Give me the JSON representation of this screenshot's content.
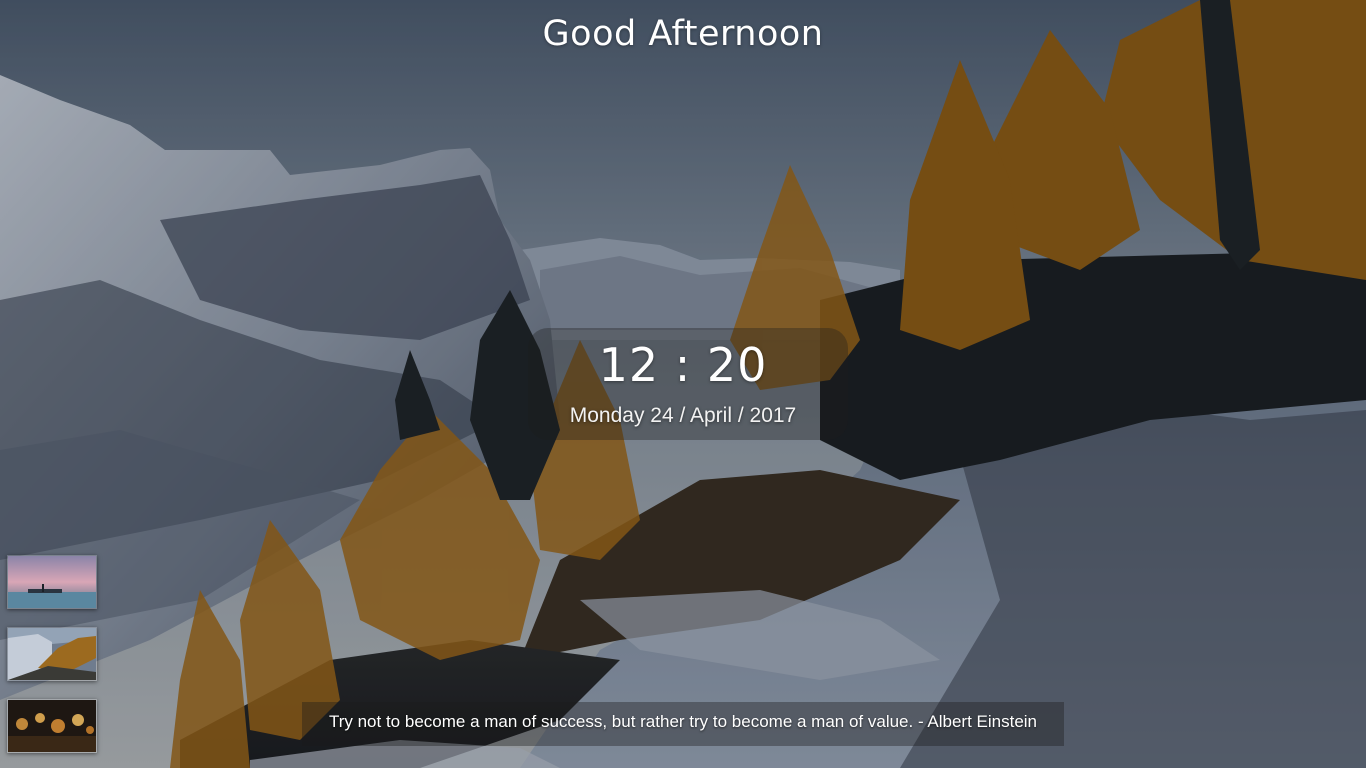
{
  "greeting": "Good Afternoon",
  "clock": {
    "time": "12 : 20",
    "date": "Monday 24 / April / 2017"
  },
  "quote": {
    "text": "Try not to become a man of success, but rather try to become a man of value. - Albert Einstein"
  },
  "wallpaper_thumbnails": [
    {
      "icon": "lake-sunset-thumbnail"
    },
    {
      "icon": "mountain-forest-thumbnail"
    },
    {
      "icon": "candles-thumbnail"
    }
  ],
  "colors": {
    "sky": "#6f7f92",
    "snow": "#c9d2de",
    "rock": "#3c4656",
    "larch": "#a8731f",
    "text": "#ffffff"
  }
}
